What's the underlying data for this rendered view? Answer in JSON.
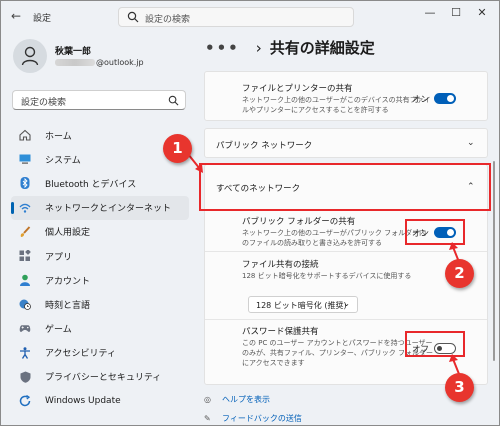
{
  "window": {
    "app_title": "設定",
    "search_placeholder": "設定の検索",
    "controls": [
      "minimize-icon",
      "maximize-icon",
      "close-icon"
    ]
  },
  "user": {
    "name": "秋葉一郎",
    "email_visible": "@outlook.jp"
  },
  "sidebar": {
    "search_placeholder": "設定の検索",
    "items": [
      {
        "label": "ホーム",
        "icon": "home-icon"
      },
      {
        "label": "システム",
        "icon": "system-icon"
      },
      {
        "label": "Bluetooth とデバイス",
        "icon": "bluetooth-icon"
      },
      {
        "label": "ネットワークとインターネット",
        "icon": "network-icon",
        "active": true
      },
      {
        "label": "個人用設定",
        "icon": "brush-icon"
      },
      {
        "label": "アプリ",
        "icon": "apps-icon"
      },
      {
        "label": "アカウント",
        "icon": "account-icon"
      },
      {
        "label": "時刻と言語",
        "icon": "globe-clock-icon"
      },
      {
        "label": "ゲーム",
        "icon": "gamepad-icon"
      },
      {
        "label": "アクセシビリティ",
        "icon": "accessibility-icon"
      },
      {
        "label": "プライバシーとセキュリティ",
        "icon": "shield-icon"
      },
      {
        "label": "Windows Update",
        "icon": "update-icon"
      }
    ]
  },
  "header": {
    "dots": "•••",
    "chevron": "›",
    "title": "共有の詳細設定"
  },
  "file_printer": {
    "title": "ファイルとプリンターの共有",
    "desc_line1": "ネットワーク上の他のユーザーがこのデバイスの共有ファイ",
    "desc_line2": "ルやプリンターにアクセスすることを許可する",
    "toggle_label": "オン",
    "toggle_on": true
  },
  "public_network": {
    "title": "パブリック ネットワーク"
  },
  "all_networks": {
    "title": "すべてのネットワーク",
    "public_folder": {
      "title": "パブリック フォルダーの共有",
      "desc_line1": "ネットワーク上の他のユーザーがパブリック フォルダー内",
      "desc_line2": "のファイルの読み取りと書き込みを許可する",
      "toggle_label": "オン",
      "toggle_on": true
    },
    "file_sharing": {
      "title": "ファイル共有の接続",
      "desc": "128 ビット暗号化をサポートするデバイスに使用する",
      "select_value": "128 ビット暗号化 (推奨)"
    },
    "password": {
      "title": "パスワード保護共有",
      "desc_line1": "この PC のユーザー アカウントとパスワードを持つユーザー",
      "desc_line2": "のみが、共有ファイル、プリンター、パブリック フォルダー",
      "desc_line3": "にアクセスできます",
      "toggle_label": "オフ",
      "toggle_on": false
    }
  },
  "links": {
    "help": "ヘルプを表示",
    "feedback": "フィードバックの送信"
  },
  "annotations": {
    "badge1": "1",
    "badge2": "2",
    "badge3": "3",
    "color": "#e8282b"
  }
}
